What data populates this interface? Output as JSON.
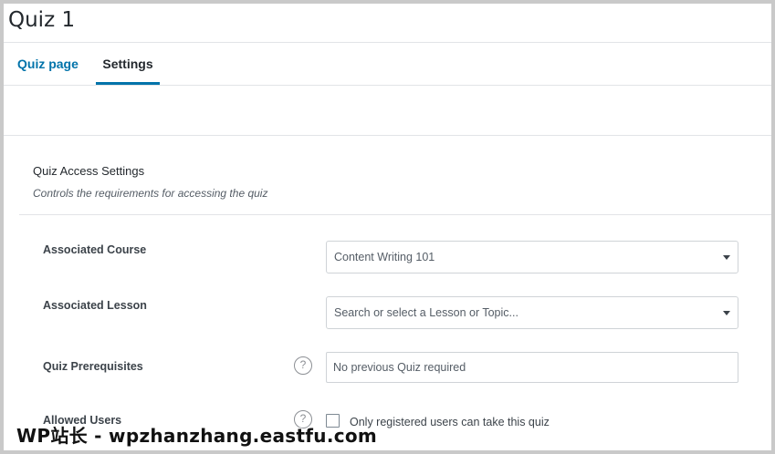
{
  "page": {
    "title": "Quiz 1"
  },
  "tabs": [
    {
      "label": "Quiz page"
    },
    {
      "label": "Settings"
    }
  ],
  "section": {
    "title": "Quiz Access Settings",
    "description": "Controls the requirements for accessing the quiz"
  },
  "fields": {
    "associated_course": {
      "label": "Associated Course",
      "value": "Content Writing 101"
    },
    "associated_lesson": {
      "label": "Associated Lesson",
      "placeholder": "Search or select a Lesson or Topic..."
    },
    "quiz_prerequisites": {
      "label": "Quiz Prerequisites",
      "placeholder": "No previous Quiz required"
    },
    "allowed_users": {
      "label": "Allowed Users",
      "checkbox_label": "Only registered users can take this quiz",
      "checked": false
    }
  },
  "help_icon_glyph": "?",
  "watermark": "WP站长 - wpzhanzhang.eastfu.com"
}
